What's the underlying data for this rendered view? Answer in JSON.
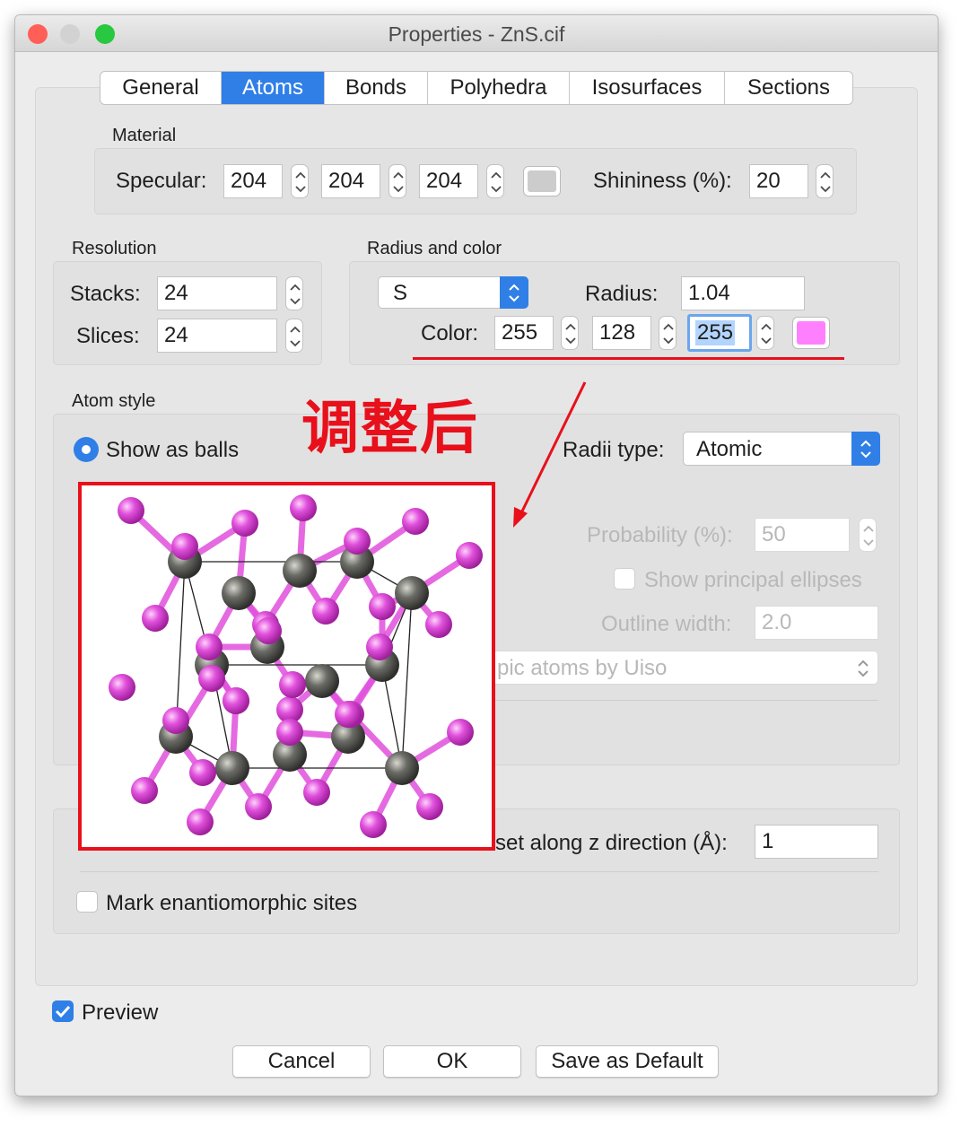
{
  "window": {
    "title": "Properties - ZnS.cif",
    "traffic_lights": {
      "close": "#ff5f57",
      "minimize": "#d2d2d2",
      "zoom": "#28c840"
    }
  },
  "tabs": [
    {
      "label": "General",
      "active": false
    },
    {
      "label": "Atoms",
      "active": true
    },
    {
      "label": "Bonds",
      "active": false
    },
    {
      "label": "Polyhedra",
      "active": false
    },
    {
      "label": "Isosurfaces",
      "active": false
    },
    {
      "label": "Sections",
      "active": false
    }
  ],
  "material": {
    "title": "Material",
    "specular_label": "Specular:",
    "specular": [
      "204",
      "204",
      "204"
    ],
    "specular_color": "#cccccc",
    "shininess_label": "Shininess (%):",
    "shininess": "20"
  },
  "resolution": {
    "title": "Resolution",
    "stacks_label": "Stacks:",
    "stacks": "24",
    "slices_label": "Slices:",
    "slices": "24"
  },
  "radius_color": {
    "title": "Radius and color",
    "element": "S",
    "radius_label": "Radius:",
    "radius": "1.04",
    "color_label": "Color:",
    "color": [
      "255",
      "128",
      "255"
    ],
    "color_swatch": "#ff80ff"
  },
  "atom_style": {
    "title": "Atom style",
    "show_as_balls": "Show as balls",
    "radii_type_label": "Radii type:",
    "radii_type": "Atomic",
    "probability_label": "Probability (%):",
    "probability": "50",
    "show_principal_ellipses": "Show principal ellipses",
    "outline_width_label": "Outline width:",
    "outline_width": "2.0",
    "isotropic_partial": "pic atoms by Uiso"
  },
  "lower": {
    "offset_label_partial": "set along z direction (Å):",
    "offset": "1",
    "mark_enantiomorphic": "Mark enantiomorphic sites"
  },
  "preview": {
    "label": "Preview",
    "checked": true
  },
  "buttons": {
    "cancel": "Cancel",
    "ok": "OK",
    "save_default": "Save as Default"
  },
  "annotation": {
    "text": "调整后",
    "color": "#e8101b"
  },
  "structure_colors": {
    "zinc": "#6b6b66",
    "sulfur": "#e050dc",
    "cell_edges": "#222222"
  }
}
